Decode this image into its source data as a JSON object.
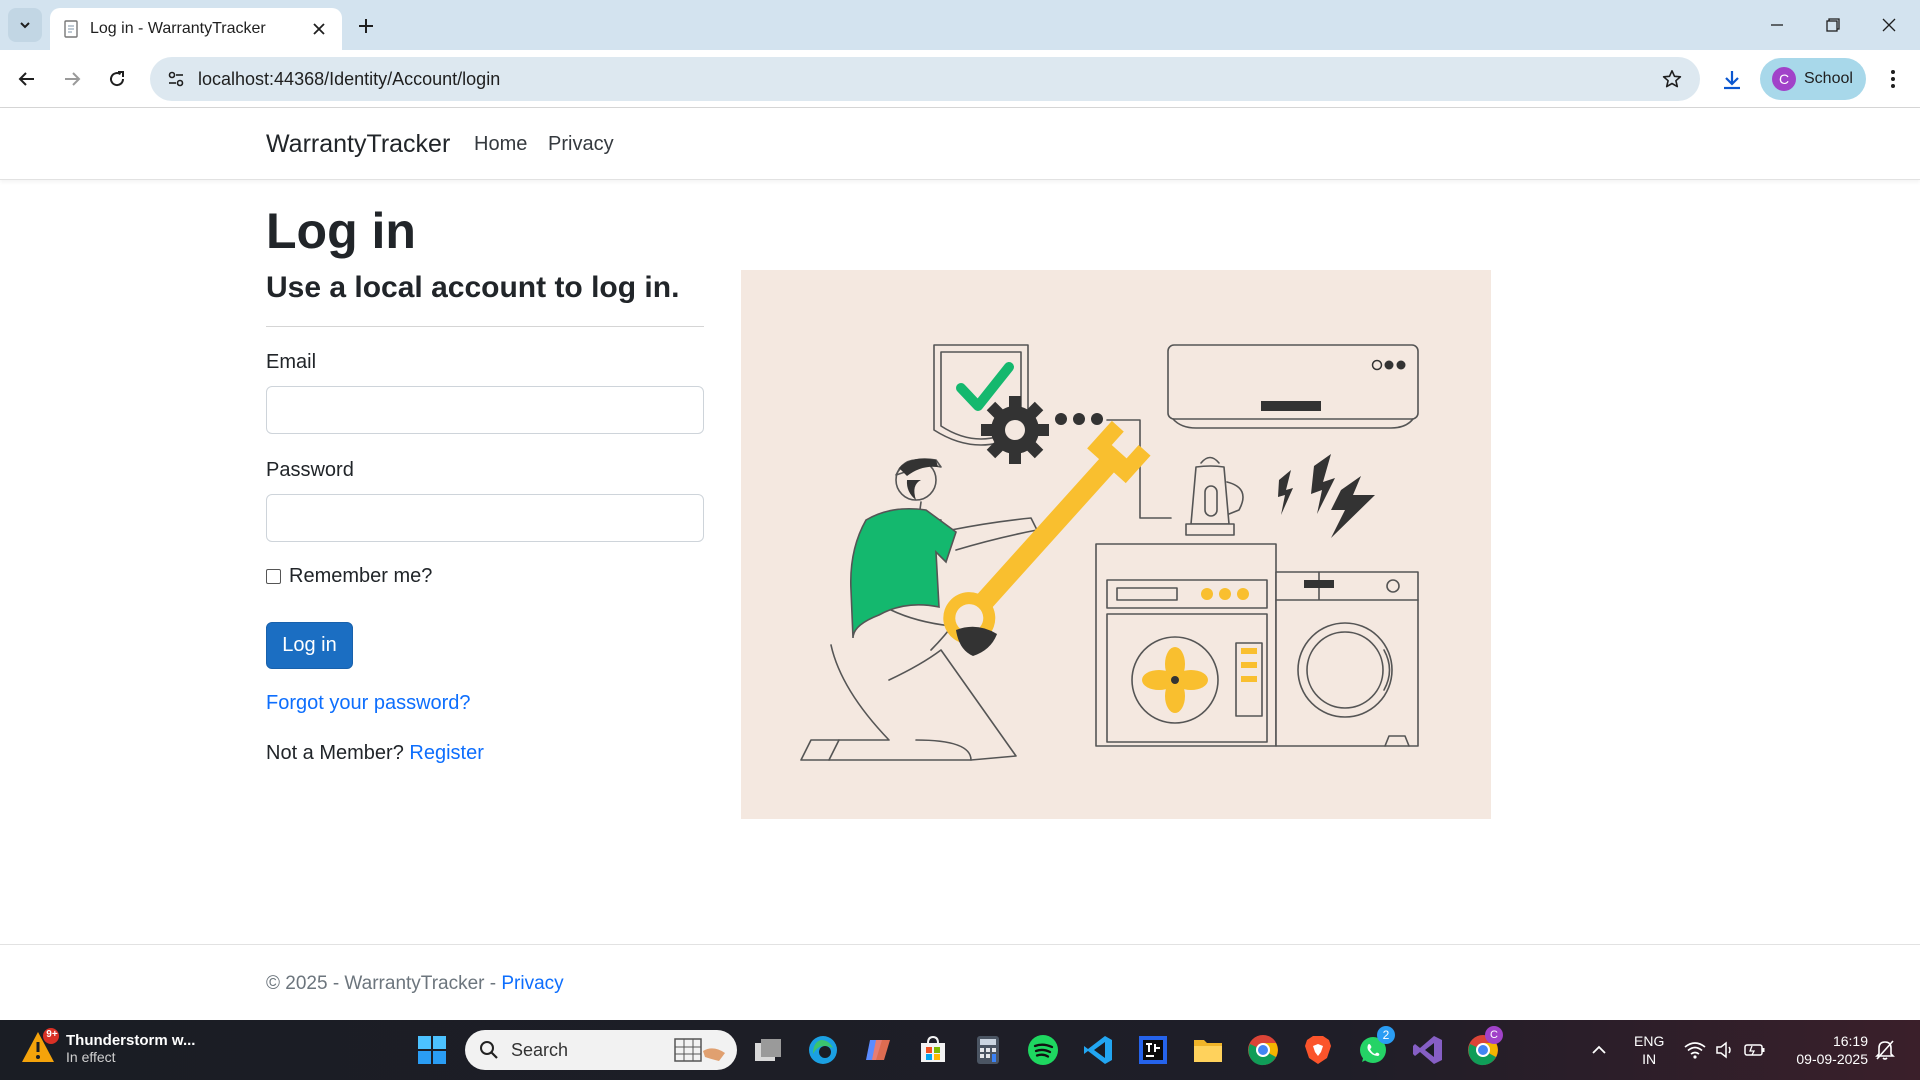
{
  "browser": {
    "tab_title": "Log in - WarrantyTracker",
    "url": "localhost:44368/Identity/Account/login",
    "profile_initial": "C",
    "profile_name": "School"
  },
  "site": {
    "brand": "WarrantyTracker",
    "nav": [
      "Home",
      "Privacy"
    ]
  },
  "login": {
    "title": "Log in",
    "subtitle": "Use a local account to log in.",
    "email_label": "Email",
    "email_value": "",
    "password_label": "Password",
    "password_value": "",
    "remember_label": "Remember me?",
    "submit_label": "Log in",
    "forgot_link": "Forgot your password?",
    "not_member_text": "Not a Member?",
    "register_link": "Register"
  },
  "footer": {
    "copyright": "© 2025 - WarrantyTracker -",
    "privacy_link": "Privacy"
  },
  "taskbar": {
    "weather_badge": "9+",
    "weather_title": "Thunderstorm w...",
    "weather_sub": "In effect",
    "search_label": "Search",
    "whatsapp_badge": "2",
    "chrome_badge": "C",
    "lang_top": "ENG",
    "lang_bottom": "IN",
    "time": "16:19",
    "date": "09-09-2025"
  },
  "colors": {
    "primary": "#1b6ec2",
    "link": "#0d6efd",
    "illustration_bg": "#f4e8e0",
    "accent_green": "#14b86e",
    "accent_yellow": "#f9bf2f"
  }
}
